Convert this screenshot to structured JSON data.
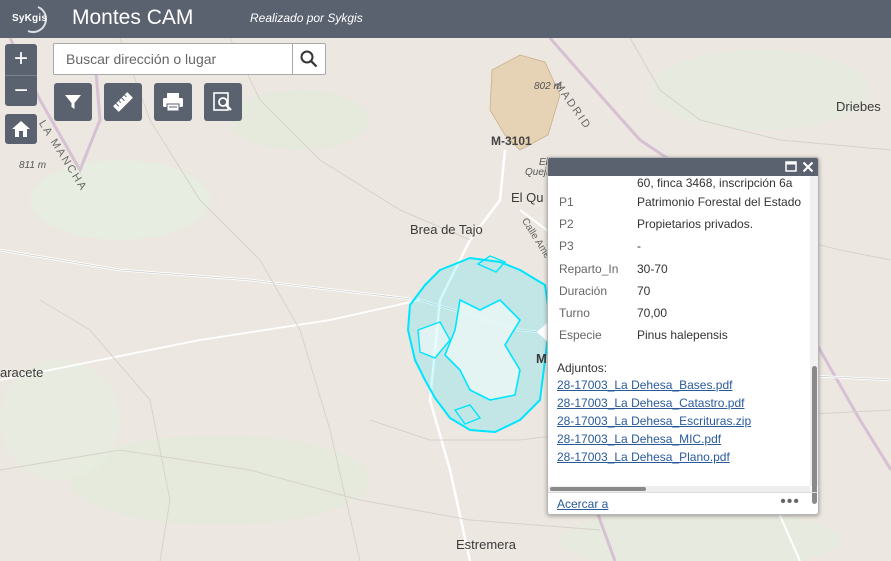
{
  "header": {
    "logo_text": "SyKgis",
    "title": "Montes CAM",
    "subtitle": "Realizado por Sykgis"
  },
  "search": {
    "placeholder": "Buscar dirección o lugar",
    "value": ""
  },
  "controls": {
    "zoom_in": "+",
    "zoom_out": "−"
  },
  "map_labels": {
    "madrid": "MADRID",
    "mancha": "LA MANCHA",
    "m3101": "M-3101",
    "el_quejigal": "El Quejigal",
    "el_qu": "El Qu",
    "brea": "Brea de Tajo",
    "calle": "Calle Ame",
    "driebes": "Driebes",
    "aracete": "aracete",
    "estremera": "Estremera",
    "m": "M",
    "el_small": "El",
    "queji_small": "Queji",
    "elev_811": "811 m",
    "elev_802": "802 m"
  },
  "popup": {
    "partial_line": "60, finca 3468, inscripción 6a",
    "fields": [
      {
        "key": "P1",
        "value": "Patrimonio Forestal del Estado"
      },
      {
        "key": "P2",
        "value": "Propietarios privados."
      },
      {
        "key": "P3",
        "value": "-"
      },
      {
        "key": "Reparto_In",
        "value": "30-70"
      },
      {
        "key": "Duración",
        "value": "70"
      },
      {
        "key": "Turno",
        "value": "70,00"
      },
      {
        "key": "Especie",
        "value": "Pinus halepensis"
      }
    ],
    "attachments_label": "Adjuntos:",
    "attachments": [
      "28-17003_La Dehesa_Bases.pdf",
      "28-17003_La Dehesa_Catastro.pdf",
      "28-17003_La Dehesa_Escrituras.zip",
      "28-17003_La Dehesa_MIC.pdf",
      "28-17003_La Dehesa_Plano.pdf"
    ],
    "zoom_to": "Acercar a",
    "more": "•••"
  },
  "colors": {
    "header": "#5a6270",
    "selection": "#00e5ff",
    "link": "#2a5a9a"
  }
}
